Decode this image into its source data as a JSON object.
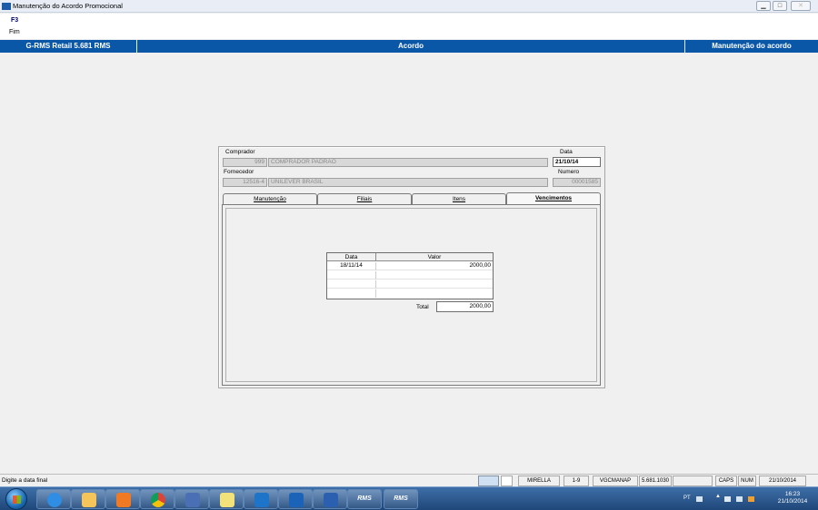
{
  "window": {
    "title": "Manutenção do Acordo Promocional",
    "controls": [
      "minimize",
      "maximize",
      "close"
    ]
  },
  "menu": {
    "key": "F3",
    "label": "Fim"
  },
  "header": {
    "app": "G-RMS Retail 5.681 RMS",
    "module": "Acordo",
    "screen": "Manutenção do acordo"
  },
  "form": {
    "comprador_label": "Comprador",
    "comprador_code": "999",
    "comprador_name": "COMPRADOR PADRAO",
    "data_label": "Data",
    "data_value": "21/10/14",
    "fornecedor_label": "Fornecedor",
    "fornecedor_code": "12516-4",
    "fornecedor_name": "UNILEVER BRASIL",
    "numero_label": "Numero",
    "numero_value": "00001585"
  },
  "tabs": [
    {
      "label": "Manutenção",
      "active": false
    },
    {
      "label": "Filiais",
      "active": false
    },
    {
      "label": "Itens",
      "active": false
    },
    {
      "label": "Vencimentos",
      "active": true
    }
  ],
  "grid": {
    "columns": [
      "Data",
      "Valor"
    ],
    "rows": [
      {
        "data": "18/11/14",
        "valor": "2000,00"
      }
    ]
  },
  "total": {
    "label": "Total",
    "value": "2000,00"
  },
  "statusbar": {
    "message": "Digite a data final",
    "user": "MIRELLA",
    "range": "1-9",
    "program": "VGCMANAP",
    "version": "5.681.1030",
    "caps": "CAPS",
    "num": "NUM",
    "date": "21/10/2014"
  },
  "taskbar": {
    "apps": [
      "Internet Explorer",
      "Windows Explorer",
      "Windows Media Player",
      "Chrome",
      "Unknown app",
      "Unknown app",
      "Lync",
      "Outlook",
      "Word",
      "RMS",
      "RMS"
    ],
    "rms_label": "RMS",
    "lang": "PT",
    "time": "16:23",
    "date": "21/10/2014"
  },
  "colors": {
    "header_blue": "#0a57a7",
    "taskbar_blue": "#1f4779"
  }
}
